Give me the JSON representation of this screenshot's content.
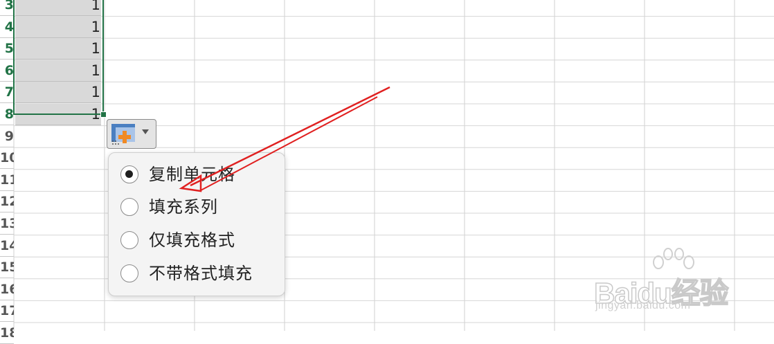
{
  "spreadsheet": {
    "rows": [
      {
        "number": "3",
        "value": "1",
        "selected": true
      },
      {
        "number": "4",
        "value": "1",
        "selected": true
      },
      {
        "number": "5",
        "value": "1",
        "selected": true
      },
      {
        "number": "6",
        "value": "1",
        "selected": true
      },
      {
        "number": "7",
        "value": "1",
        "selected": true
      },
      {
        "number": "8",
        "value": "1",
        "selected": true
      },
      {
        "number": "9",
        "value": "",
        "selected": false
      },
      {
        "number": "10",
        "value": "",
        "selected": false
      },
      {
        "number": "11",
        "value": "",
        "selected": false
      },
      {
        "number": "12",
        "value": "",
        "selected": false
      },
      {
        "number": "13",
        "value": "",
        "selected": false
      },
      {
        "number": "14",
        "value": "",
        "selected": false
      },
      {
        "number": "15",
        "value": "",
        "selected": false
      },
      {
        "number": "16",
        "value": "",
        "selected": false
      },
      {
        "number": "17",
        "value": "",
        "selected": false
      },
      {
        "number": "18",
        "value": "",
        "selected": false
      }
    ]
  },
  "autofill_options": {
    "icon": "autofill-options-icon",
    "items": [
      {
        "label": "复制单元格",
        "checked": true
      },
      {
        "label": "填充系列",
        "checked": false
      },
      {
        "label": "仅填充格式",
        "checked": false
      },
      {
        "label": "不带格式填充",
        "checked": false
      }
    ]
  },
  "watermark": {
    "logo_text": "Baidu经验",
    "url": "jingyan.baidu.com"
  },
  "colors": {
    "selection": "#217346",
    "annotation_arrow": "#e02020",
    "selected_fill": "#d9d9d9"
  }
}
